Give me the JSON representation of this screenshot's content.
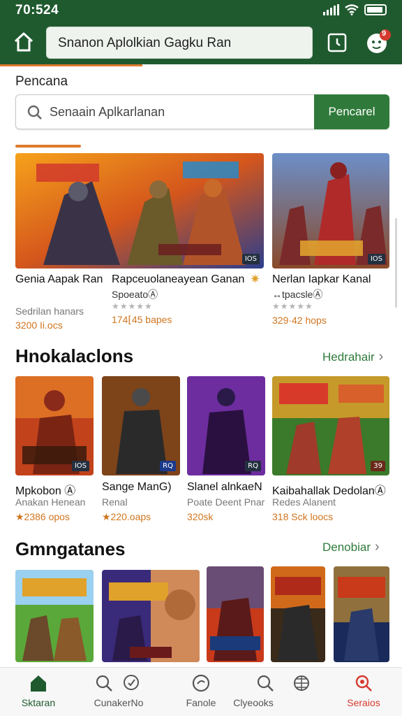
{
  "status_bar": {
    "time": "70:524"
  },
  "app_bar": {
    "url_text": "Snanon Aplolkian Gagku Ran",
    "notification_count": "9"
  },
  "search_section": {
    "label": "Pencana",
    "placeholder": "Senaain Aplkarlanan",
    "button_label": "Pencarel"
  },
  "featured": [
    {
      "title": "Genia Aapak Ran",
      "subtitle": "Sedrilan hanars",
      "meta": "3200 Ii.ocs",
      "badge": "IOS"
    },
    {
      "title": "Rapceuolaneayean Ganan",
      "subtitle": "SpoeatoⒶ",
      "stars": "★★★★★",
      "meta": "174⁅45 bapes",
      "badge": "IOS"
    },
    {
      "title": "Nerlan Iapkar Kanal",
      "subtitle": "↔tpacsleⒶ",
      "stars": "★★★★★",
      "meta": "329·42 hops",
      "badge": "IOS"
    }
  ],
  "section2": {
    "title": "Hnokalaclons",
    "link": "Hedrahair",
    "items": [
      {
        "title": "Mpkobon Ⓐ",
        "subtitle": "Anakan Henean",
        "meta": "★2386 opos",
        "badge": "IOS"
      },
      {
        "title": "Sange ManG)",
        "subtitle": "Renal",
        "meta": "★220.oaps",
        "badge": "RQ"
      },
      {
        "title": "Slanel alnkaeN",
        "subtitle": "Poate Deent Pnar",
        "meta": "320sk",
        "badge": "RQ"
      },
      {
        "title": "Kaibahallak DedolanⒶ",
        "subtitle": "Redes Alanent",
        "meta": "318 Sck loocs",
        "badge": "39"
      }
    ]
  },
  "section3": {
    "title": "Gmngatanes",
    "link": "Denobiar"
  },
  "bottom_nav": [
    {
      "label": "Sktaran",
      "icon": "home-icon"
    },
    {
      "label": "CunakerNo",
      "icon": "search-icon"
    },
    {
      "label": "Fanole",
      "icon": "chat-icon"
    },
    {
      "label": "Clyeooks",
      "icon": "search-icon"
    },
    {
      "label": "Seraios",
      "icon": "search-icon"
    }
  ],
  "colors": {
    "brand_green": "#1f5a2f",
    "accent_orange": "#e07b2e",
    "button_green": "#2f7a3a",
    "alert_red": "#d63a2f"
  }
}
